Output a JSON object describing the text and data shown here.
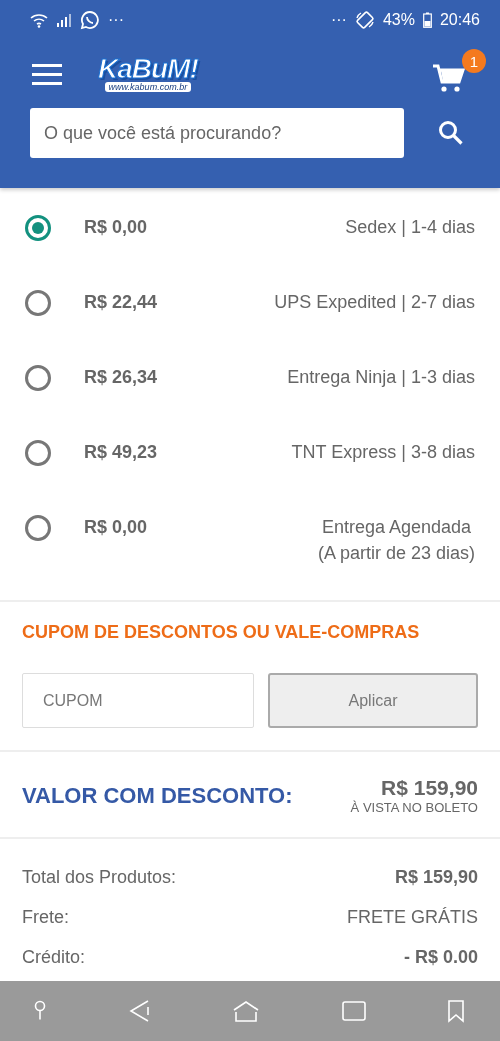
{
  "status_bar": {
    "left_more": "···",
    "right_more": "···",
    "battery": "43%",
    "time": "20:46"
  },
  "header": {
    "logo": "KaBuM!",
    "logo_url": "www.kabum.com.br",
    "cart_count": "1",
    "search": {
      "placeholder": "O que você está procurando?"
    }
  },
  "shipping_options": [
    {
      "price": "R$ 0,00",
      "service": "Sedex | 1-4 dias",
      "selected": true
    },
    {
      "price": "R$ 22,44",
      "service": "UPS Expedited | 2-7 dias",
      "selected": false
    },
    {
      "price": "R$ 26,34",
      "service": "Entrega Ninja | 1-3 dias",
      "selected": false
    },
    {
      "price": "R$ 49,23",
      "service": "TNT Express | 3-8 dias",
      "selected": false
    },
    {
      "price": "R$ 0,00",
      "service": "Entrega Agendada",
      "note": "(A partir de 23 dias)",
      "selected": false
    }
  ],
  "coupon": {
    "title": "CUPOM DE DESCONTOS OU VALE-COMPRAS",
    "placeholder": "CUPOM",
    "button": "Aplicar"
  },
  "discount": {
    "label": "VALOR COM DESCONTO:",
    "value": "R$ 159,90",
    "note": "À VISTA NO BOLETO"
  },
  "totals": [
    {
      "label": "Total dos Produtos:",
      "value": "R$ 159,90",
      "bold": true
    },
    {
      "label": "Frete:",
      "value": "FRETE GRÁTIS",
      "bold": false
    },
    {
      "label": "Crédito:",
      "value": "- R$ 0.00",
      "bold": true
    }
  ]
}
